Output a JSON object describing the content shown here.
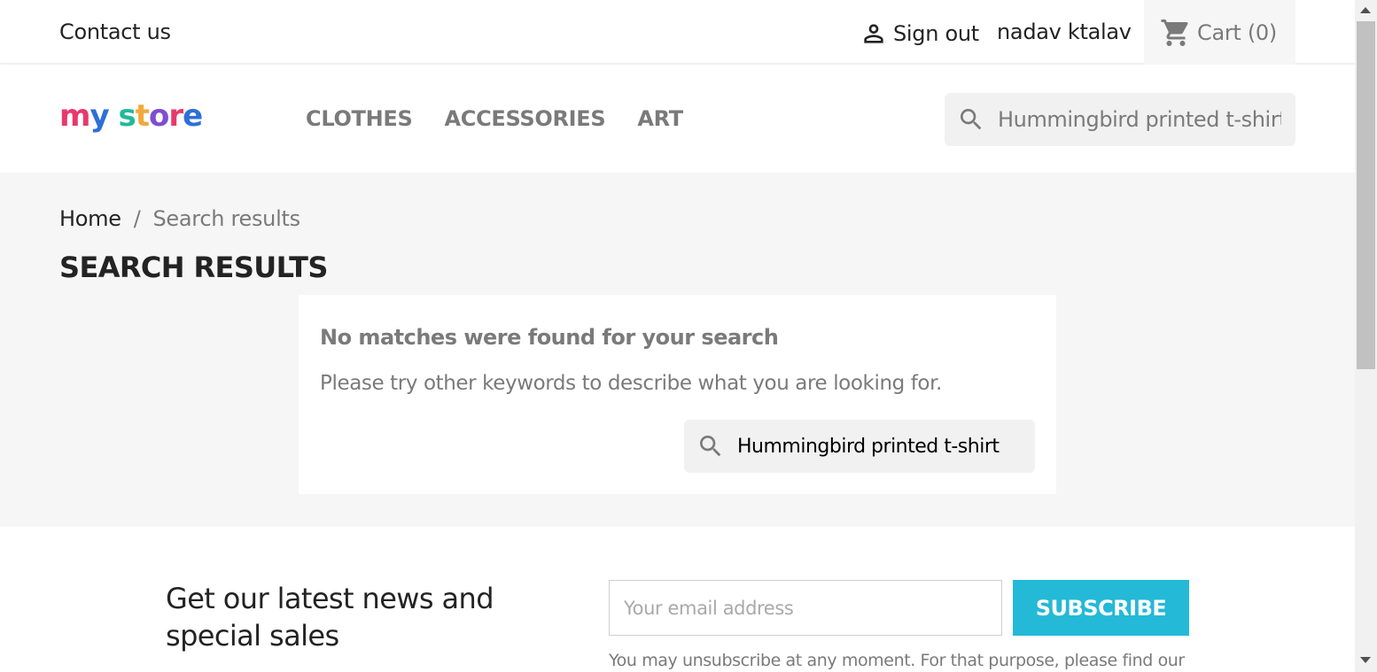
{
  "topbar": {
    "contact_label": "Contact us",
    "signout_label": "Sign out",
    "username": "nadav ktalav",
    "cart_label": "Cart (0)",
    "icons": [
      "user-icon",
      "cart-icon"
    ]
  },
  "header": {
    "logo_text": "my store",
    "nav": [
      "CLOTHES",
      "ACCESSORIES",
      "ART"
    ],
    "search_value": "Hummingbird printed t-shirt"
  },
  "breadcrumb": {
    "home": "Home",
    "separator": "/",
    "current": "Search results"
  },
  "page_title": "SEARCH RESULTS",
  "no_results": {
    "title": "No matches were found for your search",
    "description": "Please try other keywords to describe what you are looking for.",
    "search_value": "Hummingbird printed t-shirt"
  },
  "newsletter": {
    "title_line1": "Get our latest news and",
    "title_line2": "special sales",
    "email_placeholder": "Your email address",
    "subscribe_label": "SUBSCRIBE",
    "note": "You may unsubscribe at any moment. For that purpose, please find our"
  },
  "colors": {
    "accent": "#24b9d7",
    "text": "#232323",
    "muted": "#7a7a7a",
    "background": "#f6f6f6"
  }
}
